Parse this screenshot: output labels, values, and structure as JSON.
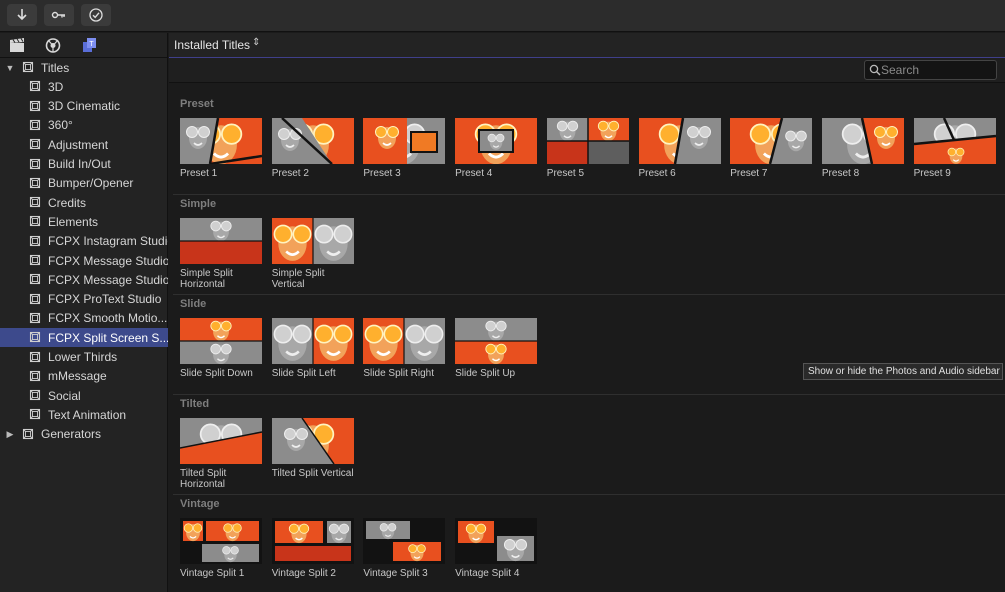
{
  "toolbar": {
    "buttons": [
      {
        "icon": "import-arrow-icon"
      },
      {
        "icon": "key-icon"
      },
      {
        "icon": "checkmark-circle-icon"
      }
    ]
  },
  "sidebar": {
    "tabs": [
      {
        "icon": "clapper-icon"
      },
      {
        "icon": "photos-audio-icon"
      },
      {
        "icon": "titles-generators-icon"
      }
    ],
    "titles_root": "Titles",
    "items": [
      {
        "label": "3D"
      },
      {
        "label": "3D Cinematic"
      },
      {
        "label": "360°"
      },
      {
        "label": "Adjustment"
      },
      {
        "label": "Build In/Out"
      },
      {
        "label": "Bumper/Opener"
      },
      {
        "label": "Credits"
      },
      {
        "label": "Elements"
      },
      {
        "label": "FCPX Instagram Studio"
      },
      {
        "label": "FCPX Message Studio"
      },
      {
        "label": "FCPX Message Studio ("
      },
      {
        "label": "FCPX ProText Studio"
      },
      {
        "label": "FCPX Smooth Motio..."
      },
      {
        "label": "FCPX Split Screen S..."
      },
      {
        "label": "Lower Thirds"
      },
      {
        "label": "mMessage"
      },
      {
        "label": "Social"
      },
      {
        "label": "Text Animation"
      }
    ],
    "selected_index": 13,
    "generators_root": "Generators"
  },
  "browser": {
    "title": "Installed Titles",
    "title_chevron": "⌃⌄"
  },
  "search": {
    "placeholder": "Search"
  },
  "sections": [
    {
      "title": "Preset",
      "items": [
        {
          "label": "Preset 1"
        },
        {
          "label": "Preset 2"
        },
        {
          "label": "Preset 3"
        },
        {
          "label": "Preset 4"
        },
        {
          "label": "Preset 5"
        },
        {
          "label": "Preset 6"
        },
        {
          "label": "Preset 7"
        },
        {
          "label": "Preset 8"
        },
        {
          "label": "Preset 9"
        }
      ]
    },
    {
      "title": "Simple",
      "items": [
        {
          "label": "Simple Split Horizontal"
        },
        {
          "label": "Simple Split Vertical"
        }
      ]
    },
    {
      "title": "Slide",
      "items": [
        {
          "label": "Slide Split Down"
        },
        {
          "label": "Slide Split Left"
        },
        {
          "label": "Slide Split Right"
        },
        {
          "label": "Slide Split Up"
        }
      ]
    },
    {
      "title": "Tilted",
      "items": [
        {
          "label": "Tilted Split Horizontal"
        },
        {
          "label": "Tilted Split Vertical"
        }
      ]
    },
    {
      "title": "Vintage",
      "items": [
        {
          "label": "Vintage Split 1"
        },
        {
          "label": "Vintage Split 2"
        },
        {
          "label": "Vintage Split 3"
        },
        {
          "label": "Vintage Split 4"
        }
      ]
    }
  ],
  "tooltip": "Show or hide the Photos and Audio sidebar",
  "colors": {
    "selection": "#3d4a8c",
    "accent_orange": "#e8501f",
    "grey_photo": "#8a8a8a"
  }
}
